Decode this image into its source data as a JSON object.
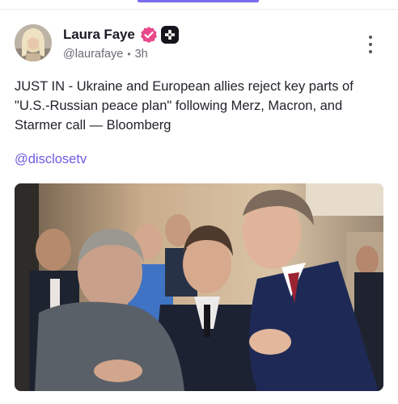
{
  "author": {
    "name": "Laura Faye",
    "handle": "@laurafaye",
    "time_ago": "3h",
    "verified_icon": "verified-badge-icon",
    "app_icon": "app-badge-icon"
  },
  "post": {
    "text": "JUST IN - Ukraine and European allies reject key parts of \"U.S.-Russian peace plan\" following Merz, Macron, and Starmer call — Bloomberg",
    "mention": "@disclosetv",
    "image_icon": "photo-image"
  },
  "menu": {
    "icon": "more-vertical-icon"
  },
  "colors": {
    "accent": "#6c5ce0",
    "verified": "#e8498a",
    "tab_indicator": "#7b6cf0"
  }
}
